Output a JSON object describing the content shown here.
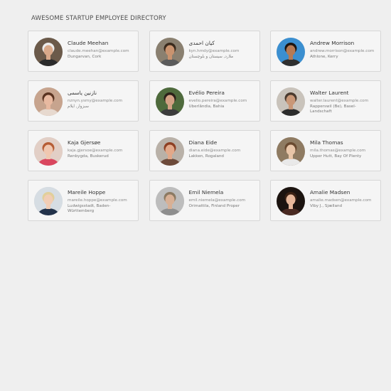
{
  "page": {
    "title": "AWESOME STARTUP EMPLOYEE DIRECTORY"
  },
  "employees": [
    {
      "name": "Claude Meehan",
      "email": "claude.meehan@example.com",
      "location": "Dungarvan, Cork",
      "avatar": {
        "bg": "#6b5a4a",
        "skin": "#d9a98a",
        "hair": "#ececec",
        "shirt": "#2b2b2b"
      }
    },
    {
      "name": "کیان احمدی",
      "email": "kyn.hmdy@example.com",
      "location": "ملارد, سیستان و بلوچستان",
      "avatar": {
        "bg": "#8a8070",
        "skin": "#c9936f",
        "hair": "#3a2a1c",
        "shirt": "#5b5b5b"
      }
    },
    {
      "name": "Andrew Morrison",
      "email": "andrew.morrison@example.com",
      "location": "Athlone, Kerry",
      "avatar": {
        "bg": "#3b8fd0",
        "skin": "#b57a55",
        "hair": "#1d1510",
        "shirt": "#2f2f2f"
      }
    },
    {
      "name": "نازنین یاسمی",
      "email": "nznyn.ysmy@example.com",
      "location": "سبزوار, ایلام",
      "avatar": {
        "bg": "#c7a48e",
        "skin": "#e8b9a0",
        "hair": "#5a3320",
        "shirt": "#e7d9cf"
      }
    },
    {
      "name": "Evélio Pereira",
      "email": "evelio.pereira@example.com",
      "location": "Uberlândia, Bahia",
      "avatar": {
        "bg": "#4e6a3c",
        "skin": "#d2a184",
        "hair": "#2b2018",
        "shirt": "#3c3c3c"
      }
    },
    {
      "name": "Walter Laurent",
      "email": "walter.laurent@example.com",
      "location": "Rapperswil (Be), Basel-Landschaft",
      "avatar": {
        "bg": "#c9c3bb",
        "skin": "#c99777",
        "hair": "#4a3a2e",
        "shirt": "#2c2c2c"
      }
    },
    {
      "name": "Kaja Gjersøe",
      "email": "kaja.gjersoe@example.com",
      "location": "Renbygda, Buskerud",
      "avatar": {
        "bg": "#e2cfc6",
        "skin": "#f0c7b0",
        "hair": "#b65d35",
        "shirt": "#d9465e"
      }
    },
    {
      "name": "Diana Eide",
      "email": "diana.eide@example.com",
      "location": "Lakken, Rogaland",
      "avatar": {
        "bg": "#b9b1a8",
        "skin": "#e2a889",
        "hair": "#8d3f22",
        "shirt": "#6d4a3a"
      }
    },
    {
      "name": "Mila Thomas",
      "email": "mila.thomas@example.com",
      "location": "Upper Hutt, Bay Of Plenty",
      "avatar": {
        "bg": "#8f7b62",
        "skin": "#e8c5a8",
        "hair": "#6a4a30",
        "shirt": "#e9e9e9"
      }
    },
    {
      "name": "Mareile Hoppe",
      "email": "mareile.hoppe@example.com",
      "location": "Ludwigsstadt, Baden-Württemberg",
      "avatar": {
        "bg": "#d6dde3",
        "skin": "#f1cdb5",
        "hair": "#e1cf9a",
        "shirt": "#22324a"
      }
    },
    {
      "name": "Emil Niemela",
      "email": "emil.niemela@example.com",
      "location": "Orimattila, Finland Proper",
      "avatar": {
        "bg": "#bdbdbd",
        "skin": "#d8b095",
        "hair": "#8c7a62",
        "shirt": "#8e8e8e"
      }
    },
    {
      "name": "Amalie Madsen",
      "email": "amalie.madsen@example.com",
      "location": "Viby J., Sjælland",
      "avatar": {
        "bg": "#1c1410",
        "skin": "#e6b79a",
        "hair": "#3b2214",
        "shirt": "#4a2a22"
      }
    }
  ]
}
